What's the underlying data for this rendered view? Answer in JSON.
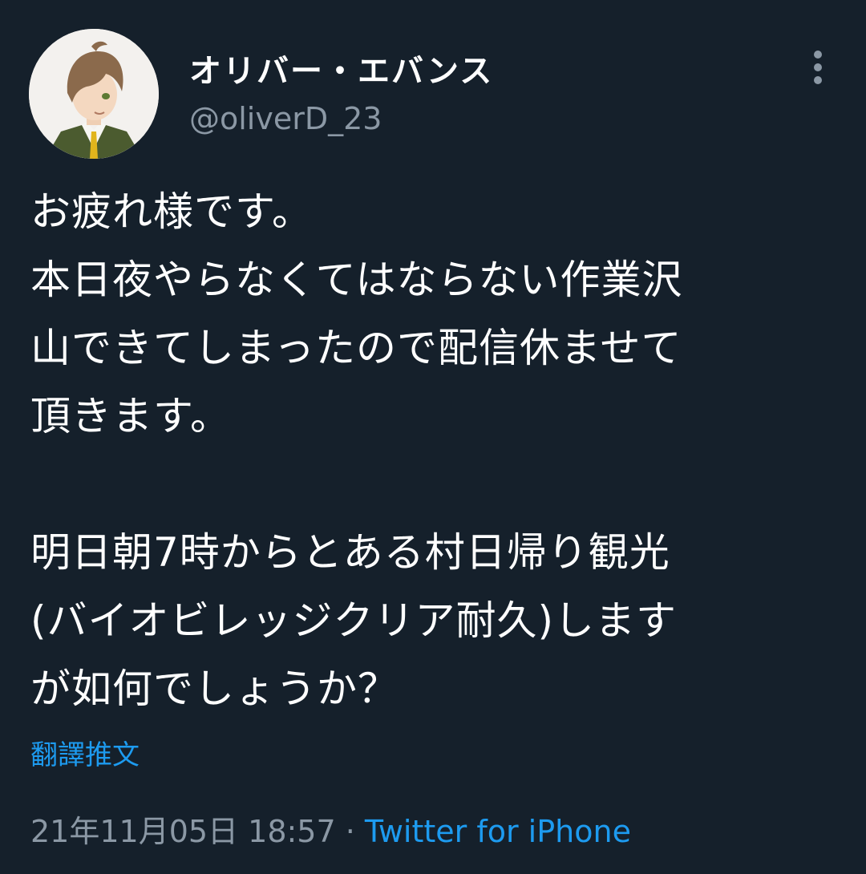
{
  "tweet": {
    "author": {
      "display_name": "オリバー・エバンス",
      "handle": "@oliverD_23"
    },
    "text": "お疲れ様です。\n本日夜やらなくてはならない作業沢\n山できてしまったので配信休ませて\n頂きます。\n\n明日朝7時からとある村日帰り観光\n(バイオビレッジクリア耐久)します\nが如何でしょうか？",
    "translate_label": "翻譯推文",
    "timestamp": "21年11月05日 18:57",
    "separator": " · ",
    "source": "Twitter for iPhone",
    "icons": {
      "more": "more-vertical-icon"
    },
    "colors": {
      "background": "#15202b",
      "text": "#ffffff",
      "secondary": "#8b98a5",
      "link": "#1d9bf0"
    }
  }
}
